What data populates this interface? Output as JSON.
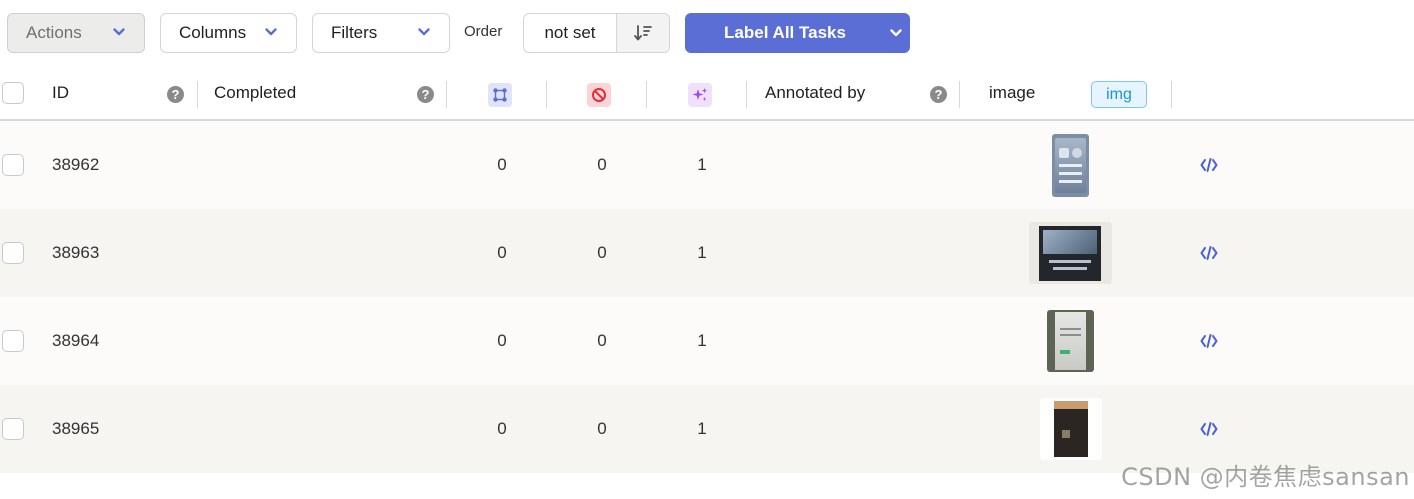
{
  "toolbar": {
    "actions_label": "Actions",
    "columns_label": "Columns",
    "filters_label": "Filters",
    "order_label": "Order",
    "order_value": "not set",
    "primary_label": "Label All Tasks"
  },
  "table": {
    "headers": {
      "id": "ID",
      "completed": "Completed",
      "annotated_by": "Annotated by",
      "image": "image",
      "image_badge": "img"
    },
    "header_icons": [
      "annotations-count-icon",
      "cancelled-count-icon",
      "predictions-count-icon"
    ],
    "rows": [
      {
        "id": "38962",
        "annotations": "0",
        "cancelled": "0",
        "predictions": "1"
      },
      {
        "id": "38963",
        "annotations": "0",
        "cancelled": "0",
        "predictions": "1"
      },
      {
        "id": "38964",
        "annotations": "0",
        "cancelled": "0",
        "predictions": "1"
      },
      {
        "id": "38965",
        "annotations": "0",
        "cancelled": "0",
        "predictions": "1"
      }
    ]
  },
  "colors": {
    "primary": "#5b6ed6",
    "annotations_icon_bg": "#dfe4fb",
    "cancelled_icon_bg": "#fbd5d5",
    "predictions_icon_bg": "#efe1fb",
    "badge_blue": "#1a93d8"
  },
  "watermark": "CSDN @内卷焦虑sansan"
}
